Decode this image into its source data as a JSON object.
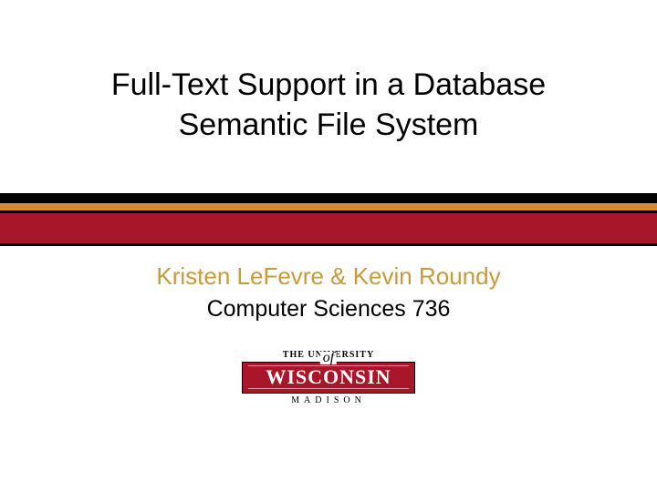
{
  "title": {
    "line1": "Full-Text Support in a Database",
    "line2": "Semantic File System"
  },
  "authors": "Kristen LeFevre & Kevin Roundy",
  "course": "Computer Sciences 736",
  "logo": {
    "top": "THE UNIVERSITY",
    "of": "of",
    "main": "WISCONSIN",
    "bottom": "MADISON"
  },
  "colors": {
    "red": "#a8162a",
    "orange": "#d98a2e",
    "gold": "#c89a3a",
    "black": "#000000"
  }
}
